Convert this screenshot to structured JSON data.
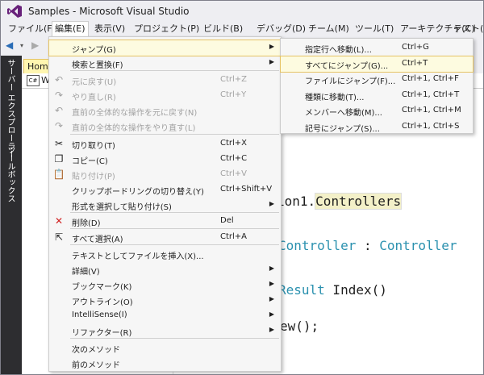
{
  "window": {
    "title": "Samples - Microsoft Visual Studio"
  },
  "menubar": [
    "ファイル(F)",
    "編集(E)",
    "表示(V)",
    "プロジェクト(P)",
    "ビルド(B)",
    "デバッグ(D)",
    "チーム(M)",
    "ツール(T)",
    "アーキテクチャ(C)",
    "テスト(S)"
  ],
  "side_tabs": [
    "サーバー エクスプローラー",
    "ツールボックス"
  ],
  "doc_tab": "Home",
  "nav_bar": {
    "icon": "C#",
    "text": "We"
  },
  "code_lines": [
    {
      "plain": "ion1.",
      "hl": "Controllers"
    },
    {
      "type": "Controller",
      "mid": " : ",
      "type2": "Controller"
    },
    {
      "type": "Result",
      "rest": " Index()"
    },
    {
      "plain": "ew();"
    }
  ],
  "edit_menu": [
    {
      "label": "ジャンプ(G)",
      "submenu": true,
      "icon": "",
      "shortcut": ""
    },
    {
      "label": "検索と置換(F)",
      "submenu": true,
      "icon": "",
      "shortcut": ""
    },
    {
      "label": "元に戻す(U)",
      "shortcut": "Ctrl+Z",
      "disabled": true,
      "icon": "undo-icon"
    },
    {
      "label": "やり直し(R)",
      "shortcut": "Ctrl+Y",
      "disabled": true,
      "icon": "redo-icon"
    },
    {
      "label": "直前の全体的な操作を元に戻す(N)",
      "shortcut": "",
      "disabled": true,
      "icon": "undo-icon"
    },
    {
      "label": "直前の全体的な操作をやり直す(L)",
      "shortcut": "",
      "disabled": true,
      "icon": "redo-icon"
    },
    {
      "label": "切り取り(T)",
      "shortcut": "Ctrl+X",
      "icon": "cut-icon"
    },
    {
      "label": "コピー(C)",
      "shortcut": "Ctrl+C",
      "icon": "copy-icon"
    },
    {
      "label": "貼り付け(P)",
      "shortcut": "Ctrl+V",
      "disabled": true,
      "icon": "paste-icon"
    },
    {
      "label": "クリップボードリングの切り替え(Y)",
      "shortcut": "Ctrl+Shift+V",
      "icon": ""
    },
    {
      "label": "形式を選択して貼り付け(S)",
      "submenu": true,
      "shortcut": "",
      "icon": ""
    },
    {
      "label": "削除(D)",
      "shortcut": "Del",
      "icon": "delete-icon"
    },
    {
      "label": "すべて選択(A)",
      "shortcut": "Ctrl+A",
      "icon": "select-all-icon"
    },
    {
      "label": "テキストとしてファイルを挿入(X)...",
      "shortcut": "",
      "icon": ""
    },
    {
      "label": "詳細(V)",
      "submenu": true,
      "shortcut": "",
      "icon": ""
    },
    {
      "label": "ブックマーク(K)",
      "submenu": true,
      "shortcut": "",
      "icon": ""
    },
    {
      "label": "アウトライン(O)",
      "submenu": true,
      "shortcut": "",
      "icon": ""
    },
    {
      "label": "IntelliSense(I)",
      "submenu": true,
      "shortcut": "",
      "icon": ""
    },
    {
      "label": "リファクター(R)",
      "submenu": true,
      "shortcut": "",
      "icon": ""
    },
    {
      "label": "次のメソッド",
      "shortcut": "",
      "icon": ""
    },
    {
      "label": "前のメソッド",
      "shortcut": "",
      "icon": ""
    }
  ],
  "jump_submenu": [
    {
      "label": "指定行へ移動(L)...",
      "shortcut": "Ctrl+G"
    },
    {
      "label": "すべてにジャンプ(G)...",
      "shortcut": "Ctrl+T",
      "selected": true
    },
    {
      "label": "ファイルにジャンプ(F)...",
      "shortcut": "Ctrl+1, Ctrl+F"
    },
    {
      "label": "種類に移動(T)...",
      "shortcut": "Ctrl+1, Ctrl+T"
    },
    {
      "label": "メンバーへ移動(M)...",
      "shortcut": "Ctrl+1, Ctrl+M"
    },
    {
      "label": "記号にジャンプ(S)...",
      "shortcut": "Ctrl+1, Ctrl+S"
    }
  ],
  "colors": {
    "accent": "#68217a",
    "highlight": "#fdfbe0",
    "type": "#2b91af"
  }
}
